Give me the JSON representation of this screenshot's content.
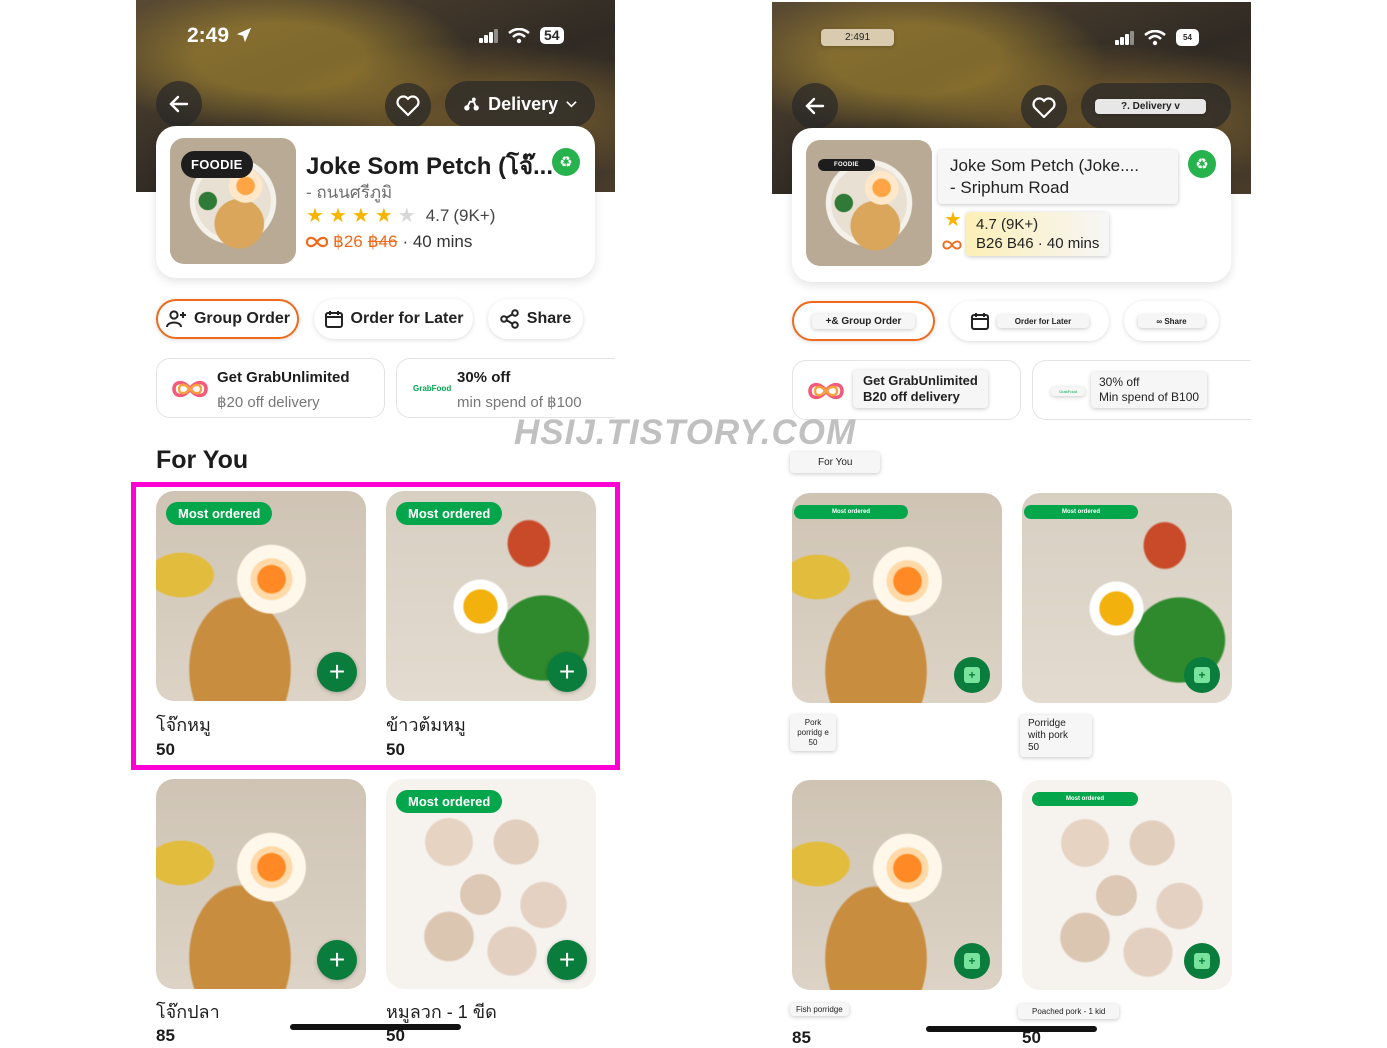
{
  "watermark": "HSIJ.TISTORY.COM",
  "left": {
    "status": {
      "time": "2:49",
      "battery": "54"
    },
    "header": {
      "delivery_label": "Delivery"
    },
    "restaurant": {
      "badge": "FOODIE",
      "name": "Joke Som Petch (โจ๊...",
      "branch": "- ถนนศรีภูมิ",
      "rating": "4.7",
      "reviews": "(9K+)",
      "stars_filled": 4,
      "price_new": "฿26",
      "price_old": "฿46",
      "eta": "· 40 mins"
    },
    "actions": {
      "group_order": "Group Order",
      "order_later": "Order for Later",
      "share": "Share"
    },
    "promos": [
      {
        "title": "Get GrabUnlimited",
        "sub": "฿20 off delivery"
      },
      {
        "brand": "GrabFood",
        "title": "30% off",
        "sub": "min spend of ฿100"
      }
    ],
    "section_title": "For You",
    "items": [
      {
        "badge": "Most ordered",
        "name": "โจ๊กหมู",
        "price": "50"
      },
      {
        "badge": "Most ordered",
        "name": "ข้าวต้มหมู",
        "price": "50"
      },
      {
        "badge": "",
        "name": "โจ๊กปลา",
        "price": "85"
      },
      {
        "badge": "Most ordered",
        "name": "หมูลวก - 1 ขีด",
        "price": "50"
      }
    ]
  },
  "right": {
    "status": {
      "time": "2:491",
      "battery": "54"
    },
    "header": {
      "delivery_label": "?. Delivery v"
    },
    "restaurant": {
      "badge": "FOODIE",
      "name_line1": "Joke Som Petch (Joke....",
      "name_line2": "- Sriphum Road",
      "rating_line": "4.7 (9K+)",
      "price_line": "B26 B46 · 40 mins"
    },
    "actions": {
      "group_order": "+& Group Order",
      "order_later": "Order for Later",
      "share": "∞ Share"
    },
    "promos": [
      {
        "title": "Get GrabUnlimited",
        "sub": "B20 off delivery"
      },
      {
        "brand": "GrabFood",
        "title": "30% off",
        "sub": "Min spend of B100"
      }
    ],
    "section_title": "For You",
    "items": [
      {
        "badge": "Most ordered",
        "name": "Pork porridg e",
        "price": "50"
      },
      {
        "badge": "Most ordered",
        "name": "Porridge with pork",
        "price": "50"
      },
      {
        "badge": "",
        "name": "Fish porridge",
        "price": "85"
      },
      {
        "badge": "Most ordered",
        "name": "Poached pork - 1 kid",
        "price": "50"
      }
    ]
  }
}
